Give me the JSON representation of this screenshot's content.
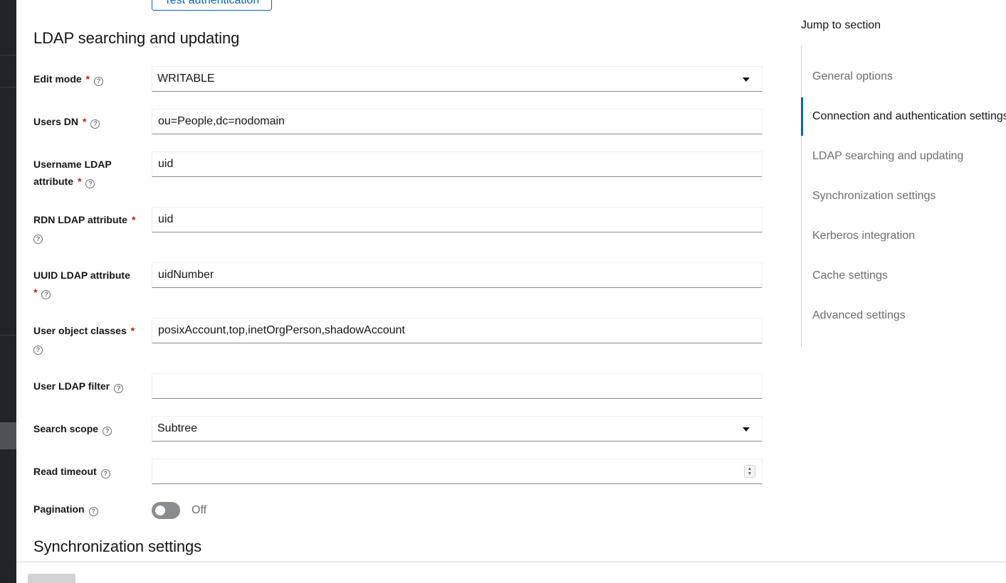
{
  "top_action": {
    "label": "Test authentication"
  },
  "sections": {
    "ldap_title": "LDAP searching and updating",
    "sync_title": "Synchronization settings"
  },
  "fields": {
    "edit_mode": {
      "label": "Edit mode",
      "value": "WRITABLE"
    },
    "users_dn": {
      "label": "Users DN",
      "value": "ou=People,dc=nodomain"
    },
    "username_attr": {
      "label_line1": "Username LDAP",
      "label_line2": "attribute",
      "value": "uid"
    },
    "rdn_attr": {
      "label": "RDN LDAP attribute",
      "value": "uid"
    },
    "uuid_attr": {
      "label": "UUID LDAP attribute",
      "value": "uidNumber"
    },
    "object_classes": {
      "label": "User object classes",
      "value": "posixAccount,top,inetOrgPerson,shadowAccount"
    },
    "ldap_filter": {
      "label": "User LDAP filter",
      "value": ""
    },
    "search_scope": {
      "label": "Search scope",
      "value": "Subtree"
    },
    "read_timeout": {
      "label": "Read timeout",
      "value": ""
    },
    "pagination": {
      "label": "Pagination",
      "state": "Off"
    }
  },
  "jump": {
    "title": "Jump to section",
    "items": [
      {
        "label": "General options"
      },
      {
        "label": "Connection and authentication settings"
      },
      {
        "label": "LDAP searching and updating"
      },
      {
        "label": "Synchronization settings"
      },
      {
        "label": "Kerberos integration"
      },
      {
        "label": "Cache settings"
      },
      {
        "label": "Advanced settings"
      }
    ],
    "active_index": 1
  },
  "colors": {
    "accent": "#0066cc",
    "required": "#c9190b",
    "nav_bg": "#212427"
  },
  "icons": {
    "help": "help-circle-icon",
    "caret": "caret-down-icon",
    "spinner": "number-spinner-icon"
  }
}
